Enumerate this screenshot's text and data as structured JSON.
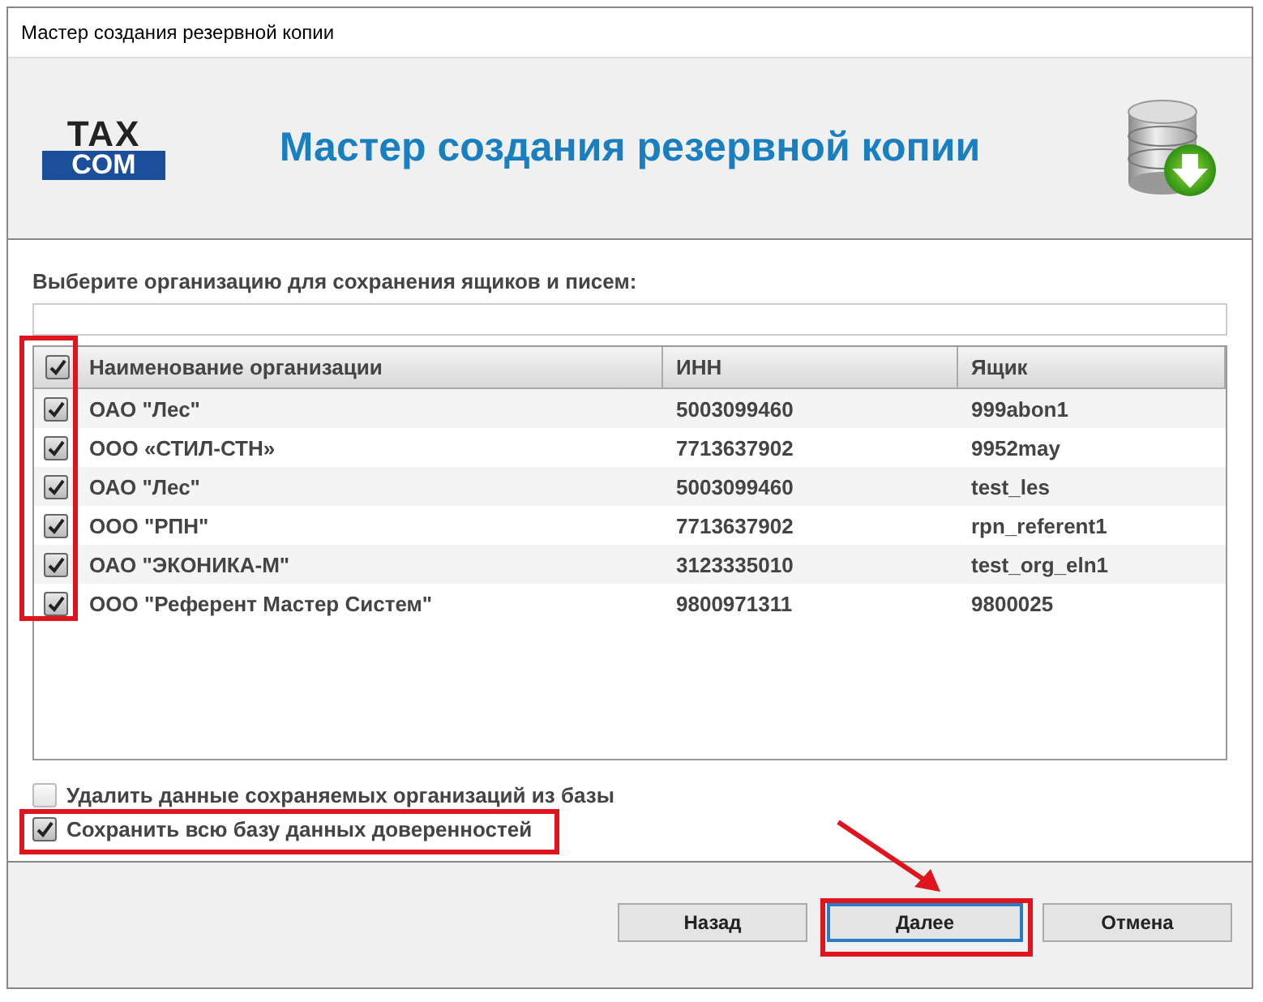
{
  "window": {
    "title": "Мастер создания резервной копии"
  },
  "header": {
    "logo_top": "TAX",
    "logo_bottom": "COM",
    "title": "Мастер создания резервной копии"
  },
  "prompt": "Выберите организацию для сохранения ящиков и писем:",
  "table": {
    "select_all_checked": true,
    "columns": [
      "Наименование организации",
      "ИНН",
      "Ящик"
    ],
    "rows": [
      {
        "checked": true,
        "cells": [
          "ОАО \"Лес\"",
          "5003099460",
          "999abon1"
        ]
      },
      {
        "checked": true,
        "cells": [
          "ООО «СТИЛ-СТН»",
          "7713637902",
          "9952may"
        ]
      },
      {
        "checked": true,
        "cells": [
          "ОАО \"Лес\"",
          "5003099460",
          "test_les"
        ]
      },
      {
        "checked": true,
        "cells": [
          "ООО \"РПН\"",
          "7713637902",
          "rpn_referent1"
        ]
      },
      {
        "checked": true,
        "cells": [
          "ОАО \"ЭКОНИКА-М\"",
          "3123335010",
          "test_org_eln1"
        ]
      },
      {
        "checked": true,
        "cells": [
          "ООО \"Референт Мастер Систем\"",
          "9800971311",
          "9800025"
        ]
      }
    ]
  },
  "options": [
    {
      "label": "Удалить данные сохраняемых организаций из базы",
      "checked": false
    },
    {
      "label": "Сохранить всю базу данных доверенностей",
      "checked": true
    }
  ],
  "buttons": [
    {
      "label": "Назад",
      "selected": false
    },
    {
      "label": "Далее",
      "selected": true
    },
    {
      "label": "Отмена",
      "selected": false
    }
  ]
}
